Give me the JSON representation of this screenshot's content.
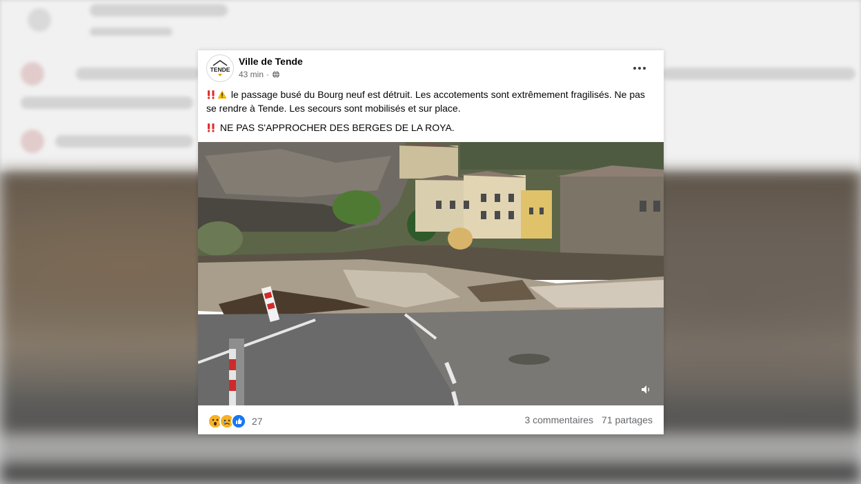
{
  "post": {
    "page_name": "Ville de Tende",
    "avatar_logo_text": "TENDE",
    "time": "43 min",
    "separator": "·",
    "paragraph1_icons": [
      "double-exclamation-icon",
      "warning-icon"
    ],
    "paragraph1": "le passage busé du Bourg neuf est détruit. Les accotements sont extrêmement fragilisés. Ne pas se rendre à Tende. Les secours sont mobilisés et sur place.",
    "paragraph2_icons": [
      "double-exclamation-icon"
    ],
    "paragraph2": "NE PAS S'APPROCHER DES BERGES DE LA ROYA.",
    "image_description_icon": "flooded-road-photo",
    "reactions": [
      "wow-icon",
      "sad-icon",
      "like-icon"
    ],
    "reaction_count": "27",
    "comments": "3 commentaires",
    "shares": "71 partages"
  },
  "colors": {
    "brand_blue": "#1877f2",
    "text_primary": "#050505",
    "text_secondary": "#65676b",
    "alert_red": "#e03131",
    "warning_yellow": "#f5b800"
  }
}
